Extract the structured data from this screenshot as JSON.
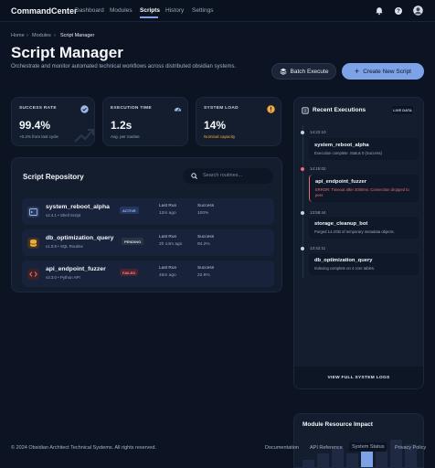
{
  "nav": {
    "brand": "CommandCenter",
    "links": [
      "Dashboard",
      "Modules",
      "Scripts",
      "History",
      "Settings"
    ],
    "active": "Scripts",
    "icons": [
      "bell-icon",
      "help-icon",
      "user-avatar"
    ]
  },
  "breadcrumb": [
    "Home",
    "Modules",
    "Script Manager"
  ],
  "header": {
    "title": "Script Manager",
    "subtitle": "Orchestrate and monitor automated technical workflows across distributed obsidian systems.",
    "batch_label": "Batch Execute",
    "create_label": "Create New Script"
  },
  "stats": [
    {
      "label": "SUCCESS RATE",
      "value": "99.4%",
      "note": "+0.2% from last cycle",
      "icon": "check-circle-icon"
    },
    {
      "label": "EXECUTION TIME",
      "value": "1.2s",
      "note": "Avg. per routine",
      "icon": "speedometer-icon"
    },
    {
      "label": "SYSTEM LOAD",
      "value": "14%",
      "note": "Nominal capacity",
      "icon": "alert-circle-icon"
    }
  ],
  "repo": {
    "title": "Script Repository",
    "search_placeholder": "Search routines...",
    "col_last_run": "Last Run",
    "col_success": "Success",
    "rows": [
      {
        "name": "system_reboot_alpha",
        "meta": "v2.4.1 • Shell Script",
        "status": "ACTIVE",
        "last_run": "12m ago",
        "success": "100%",
        "icon": "terminal-icon"
      },
      {
        "name": "db_optimization_query",
        "meta": "v1.0.8 • SQL Routine",
        "status": "PENDING",
        "last_run": "2h 14m ago",
        "success": "94.2%",
        "icon": "database-icon"
      },
      {
        "name": "api_endpoint_fuzzer",
        "meta": "v3.3.0 • Python API",
        "status": "FAILED",
        "last_run": "45m ago",
        "success": "22.8%",
        "icon": "code-icon"
      }
    ]
  },
  "executions": {
    "title": "Recent Executions",
    "live": "LIVE DATA",
    "events": [
      {
        "time": "14:22:10",
        "name": "system_reboot_alpha",
        "message": "Execution complete. Status 0 (Success)"
      },
      {
        "time": "14:15:02",
        "name": "api_endpoint_fuzzer",
        "message": "ERROR: Timeout after 3000ms. Connection dropped to peer."
      },
      {
        "time": "13:58:44",
        "name": "storage_cleanup_bot",
        "message": "Purged 14.2GB of temporary metadata objects."
      },
      {
        "time": "13:42:11",
        "name": "db_optimization_query",
        "message": "Indexing complete on 4 core tables."
      }
    ],
    "logs_label": "VIEW FULL SYSTEM LOGS"
  },
  "resource": {
    "title": "Module Resource Impact",
    "bars": [
      0.25,
      0.45,
      0.6,
      0.45,
      0.75,
      0.55,
      0.85,
      0.7
    ]
  },
  "footer": {
    "copyright": "© 2024 Obsidian Architect Technical Systems. All rights reserved.",
    "links": [
      "Documentation",
      "API Reference",
      "System Status",
      "Privacy Policy"
    ]
  },
  "colors": {
    "accent": "#7ea2e8",
    "bg": "#0c1424",
    "card": "#141d2e",
    "success": "#5fd3a0",
    "warning": "#f2a93b",
    "error": "#ef6b6b"
  }
}
